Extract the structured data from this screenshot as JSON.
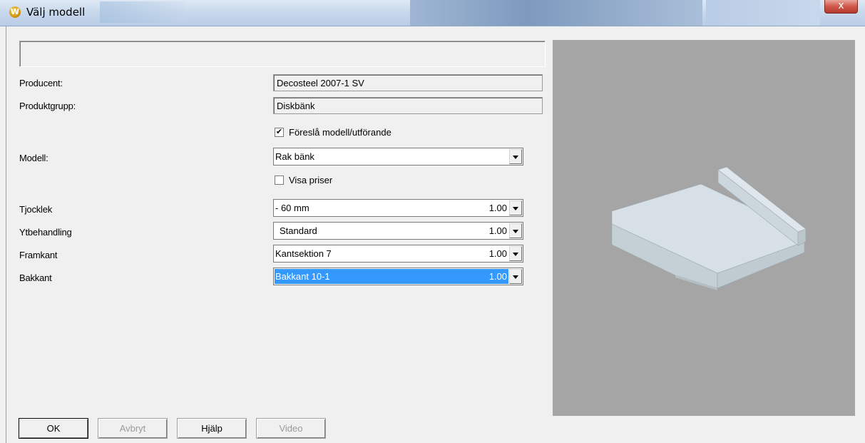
{
  "window": {
    "title": "Välj modell",
    "app_icon_letter": "W",
    "close_symbol": "x"
  },
  "form": {
    "producent_label": "Producent:",
    "producent_value": "Decosteel 2007-1 SV",
    "produktgrupp_label": "Produktgrupp:",
    "produktgrupp_value": "Diskbänk",
    "suggest_checkbox": {
      "label": "Föreslå modell/utförande",
      "checked": true,
      "check_symbol": "✔"
    },
    "modell_label": "Modell:",
    "modell_value": "Rak bänk",
    "visa_priser_checkbox": {
      "label": "Visa priser",
      "checked": false
    },
    "rows": [
      {
        "label": "Tjocklek",
        "value": "- 60 mm",
        "number": "1.00"
      },
      {
        "label": "Ytbehandling",
        "value": "Standard",
        "number": "1.00"
      },
      {
        "label": "Framkant",
        "value": "Kantsektion 7",
        "number": "1.00"
      },
      {
        "label": "Bakkant",
        "value": "Bakkant 10-1",
        "number": "1.00"
      }
    ]
  },
  "buttons": {
    "ok": "OK",
    "cancel": "Avbryt",
    "help": "Hjälp",
    "video": "Video"
  },
  "colors": {
    "preview_background": "#a5a5a5",
    "selection": "#3399ff",
    "model_face": "#d3dde4"
  }
}
